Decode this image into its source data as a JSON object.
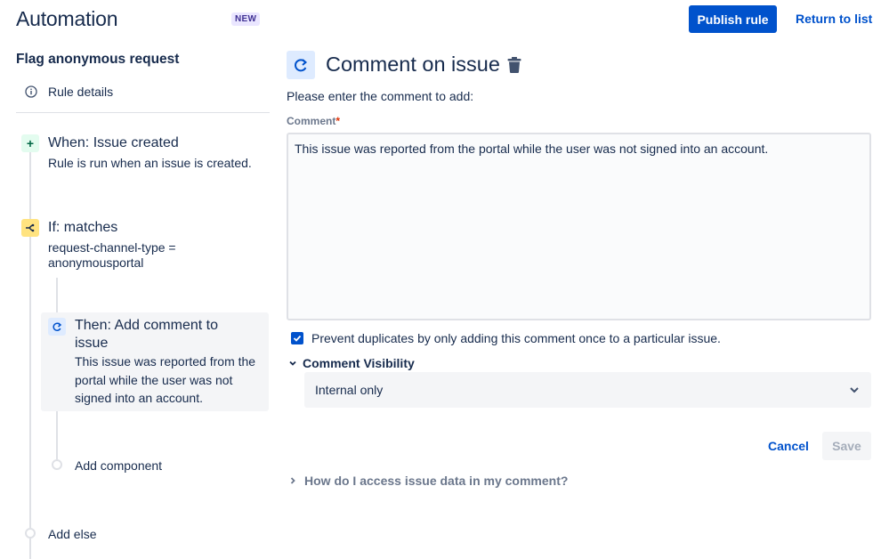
{
  "header": {
    "title": "Automation",
    "badge": "NEW",
    "publish_label": "Publish rule",
    "return_label": "Return to list"
  },
  "rule": {
    "name": "Flag anonymous request",
    "details_label": "Rule details"
  },
  "flow": {
    "trigger": {
      "title": "When: Issue created",
      "desc": "Rule is run when an issue is created.",
      "icon": "plus-icon"
    },
    "condition": {
      "title": "If: matches",
      "desc_line1": "request-channel-type =",
      "desc_line2": "anonymousportal",
      "icon": "branch-icon"
    },
    "action": {
      "title_line1": "Then: Add comment to",
      "title_line2": "issue",
      "desc_line1": "This issue was reported from the",
      "desc_line2": "portal while the user was not",
      "desc_line3": "signed into an account.",
      "icon": "comment-action-icon"
    },
    "add_component_label": "Add component",
    "add_else_label": "Add else"
  },
  "editor": {
    "title": "Comment on issue",
    "instruction": "Please enter the comment to add:",
    "comment_label": "Comment",
    "required_mark": "*",
    "comment_value": "This issue was reported from the portal while the user was not signed into an account.",
    "prevent_duplicates_label": "Prevent duplicates by only adding this comment once to a particular issue.",
    "prevent_duplicates_checked": true,
    "visibility_label": "Comment Visibility",
    "visibility_value": "Internal only",
    "cancel_label": "Cancel",
    "save_label": "Save",
    "help_label": "How do I access issue data in my comment?"
  },
  "colors": {
    "brand_blue": "#0052CC",
    "text": "#172B4D",
    "subtle_text": "#6B778C",
    "trigger_bg": "#E3FCEF",
    "condition_bg": "#FFE380",
    "action_bg": "#DEEBFF",
    "badge_bg": "#EAE6FF"
  }
}
